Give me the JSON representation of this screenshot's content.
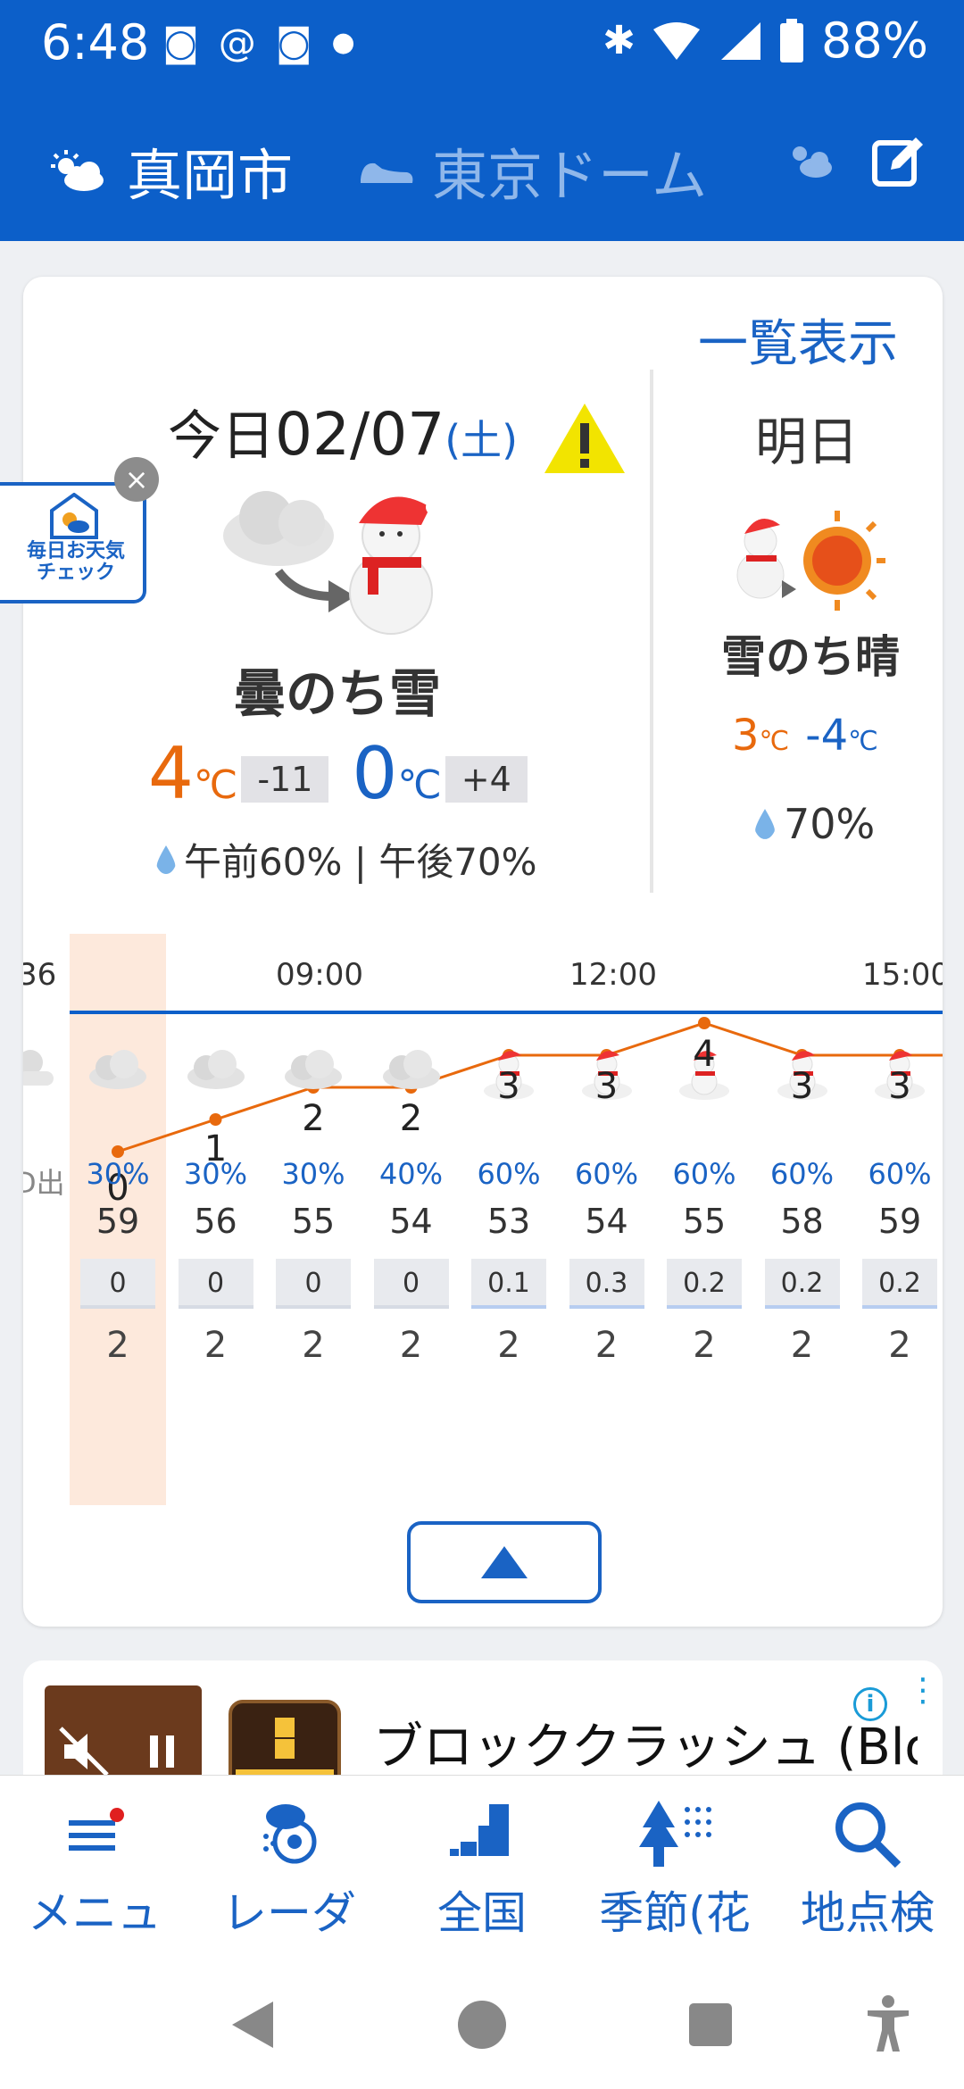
{
  "status_bar": {
    "time": "6:48",
    "battery": "88%"
  },
  "header": {
    "location_main": "真岡市",
    "location_sub": "東京ドーム"
  },
  "today": {
    "list_link": "一覧表示",
    "label": "今日",
    "date": "02/07",
    "dow": "(土)",
    "weather": "曇のち雪",
    "high": "4",
    "high_diff": "-11",
    "low": "0",
    "low_diff": "+4",
    "unit": "℃",
    "precip": "午前60% | 午後70%"
  },
  "tomorrow": {
    "label": "明日",
    "weather": "雪のち晴",
    "high": "3",
    "low": "-4",
    "unit": "℃",
    "precip": "70%"
  },
  "hourly": {
    "partial_left_hour": "36",
    "hour_labels": [
      "09:00",
      "12:00",
      "15:00"
    ],
    "row_label_partial": "D出",
    "columns": [
      {
        "icon": "cloud-icon",
        "temp": "0",
        "pop": "30%",
        "humidity": "59",
        "rain": "0",
        "wind": "2"
      },
      {
        "icon": "cloud-icon",
        "temp": "1",
        "pop": "30%",
        "humidity": "56",
        "rain": "0",
        "wind": "2"
      },
      {
        "icon": "cloud-icon",
        "temp": "2",
        "pop": "30%",
        "humidity": "55",
        "rain": "0",
        "wind": "2"
      },
      {
        "icon": "cloud-icon",
        "temp": "2",
        "pop": "40%",
        "humidity": "54",
        "rain": "0",
        "wind": "2"
      },
      {
        "icon": "snowman-icon",
        "temp": "3",
        "pop": "60%",
        "humidity": "53",
        "rain": "0.1",
        "wind": "2"
      },
      {
        "icon": "snowman-icon",
        "temp": "3",
        "pop": "60%",
        "humidity": "54",
        "rain": "0.3",
        "wind": "2"
      },
      {
        "icon": "snowman-icon",
        "temp": "4",
        "pop": "60%",
        "humidity": "55",
        "rain": "0.2",
        "wind": "2"
      },
      {
        "icon": "snowman-icon",
        "temp": "3",
        "pop": "60%",
        "humidity": "58",
        "rain": "0.2",
        "wind": "2"
      },
      {
        "icon": "snowman-icon",
        "temp": "3",
        "pop": "60%",
        "humidity": "59",
        "rain": "0.2",
        "wind": "2"
      }
    ]
  },
  "floating_badge": {
    "line1": "毎日お天気",
    "line2": "チェック"
  },
  "ad": {
    "title": "ブロッククラッシュ (Blo"
  },
  "bottom_nav": [
    "メニュ",
    "レーダ",
    "全国",
    "季節(花",
    "地点検"
  ],
  "colors": {
    "primary": "#0c5fc9",
    "accent_blue": "#1a63c4",
    "accent_orange": "#e8690d"
  }
}
